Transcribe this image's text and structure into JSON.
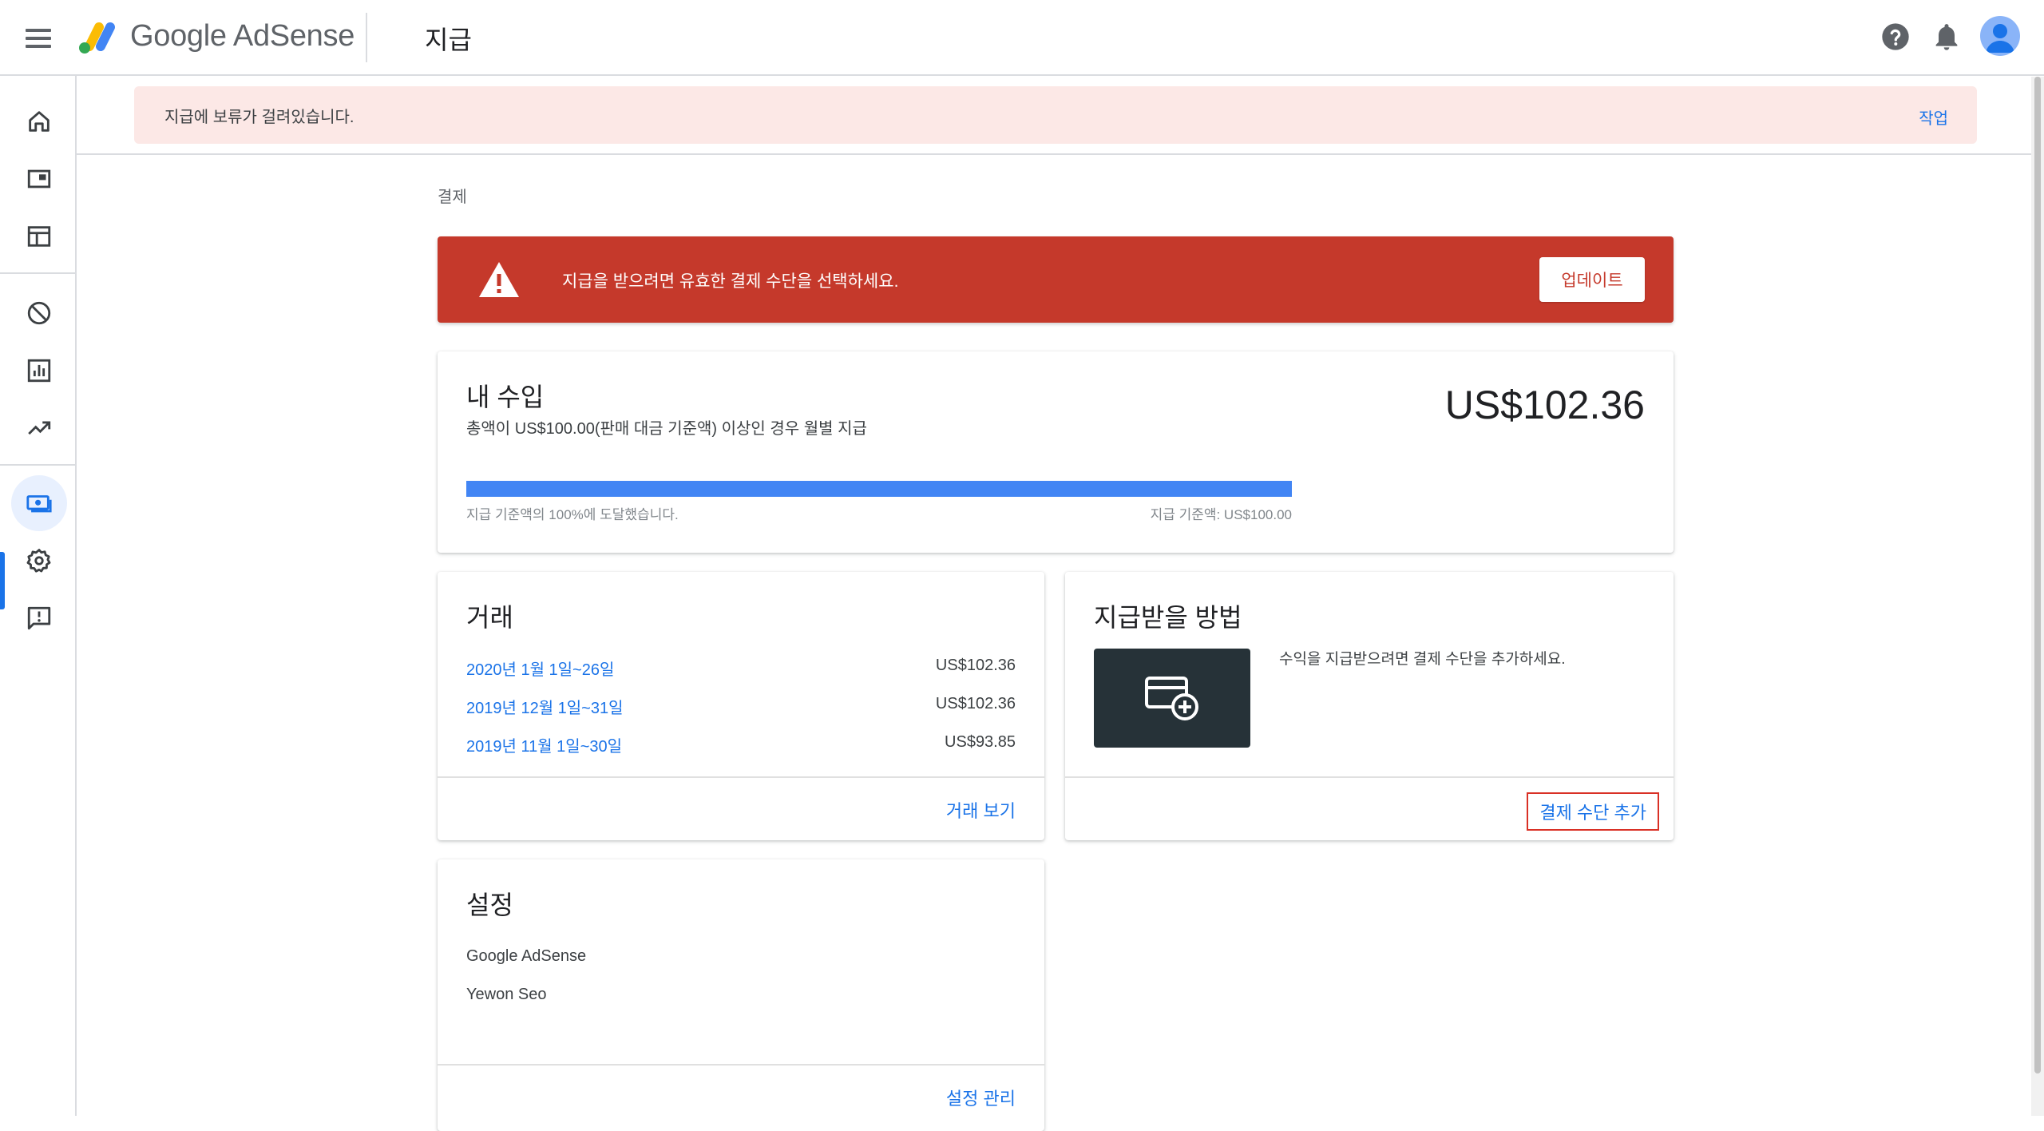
{
  "header": {
    "brand": "Google AdSense",
    "page_title": "지급"
  },
  "alert": {
    "message": "지급에 보류가 걸려있습니다.",
    "action": "작업"
  },
  "breadcrumb": "결제",
  "warning": {
    "message": "지급을 받으려면 유효한 결제 수단을 선택하세요.",
    "button": "업데이트"
  },
  "earnings": {
    "title": "내 수입",
    "description": "총액이 US$100.00(판매 대금 기준액) 이상인 경우 월별 지급",
    "amount": "US$102.36",
    "progress_percent": 100,
    "progress_label": "지급 기준액의 100%에 도달했습니다.",
    "threshold_label": "지급 기준액: US$100.00"
  },
  "transactions": {
    "title": "거래",
    "rows": [
      {
        "period": "2020년 1월 1일~26일",
        "amount": "US$102.36"
      },
      {
        "period": "2019년 12월 1일~31일",
        "amount": "US$102.36"
      },
      {
        "period": "2019년 11월 1일~30일",
        "amount": "US$93.85"
      }
    ],
    "view_link": "거래 보기"
  },
  "payment_method": {
    "title": "지급받을 방법",
    "description": "수익을 지급받으려면 결제 수단을 추가하세요.",
    "add_button": "결제 수단 추가"
  },
  "settings": {
    "title": "설정",
    "product": "Google AdSense",
    "payee_name": "Yewon Seo",
    "manage_link": "설정 관리"
  },
  "colors": {
    "accent": "#1a73e8",
    "warning_red": "#c5392b",
    "alert_bg": "#fce8e6",
    "progress": "#4285f4"
  },
  "icons": {
    "menu": "menu-icon",
    "help": "help-icon",
    "notifications": "bell-icon",
    "account": "avatar",
    "nav": [
      "home-icon",
      "ads-icon",
      "sites-icon",
      "block-icon",
      "reports-icon",
      "optimization-icon",
      "payments-icon",
      "settings-icon",
      "feedback-icon"
    ]
  }
}
